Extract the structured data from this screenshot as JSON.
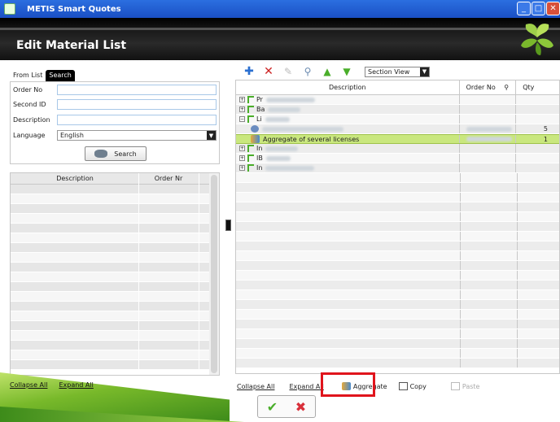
{
  "window": {
    "title": "METIS Smart Quotes"
  },
  "header": {
    "page_title": "Edit Material List"
  },
  "left": {
    "tabs": [
      {
        "label": "From List"
      },
      {
        "label": "Search"
      }
    ],
    "form": {
      "order_no_label": "Order No",
      "second_id_label": "Second ID",
      "description_label": "Description",
      "language_label": "Language",
      "language_value": "English",
      "search_button": "Search"
    },
    "list_columns": {
      "description": "Description",
      "order_nr": "Order Nr"
    },
    "links": {
      "collapse_all": "Collapse All",
      "expand_all": "Expand All"
    }
  },
  "toolbar": {
    "view_select": "Section View"
  },
  "grid": {
    "columns": {
      "description": "Description",
      "order_no": "Order No",
      "qty": "Qty"
    },
    "rows": [
      {
        "desc": "Pr",
        "qty": ""
      },
      {
        "desc": "Ba",
        "qty": ""
      },
      {
        "desc": "Li",
        "qty": ""
      },
      {
        "desc": "",
        "qty": "5"
      },
      {
        "desc": "Aggregate of several licenses",
        "qty": "1"
      },
      {
        "desc": "In",
        "qty": ""
      },
      {
        "desc": "IB",
        "qty": ""
      },
      {
        "desc": "In",
        "qty": ""
      }
    ]
  },
  "bottom": {
    "collapse_all": "Collapse All",
    "expand_all": "Expand All",
    "aggregate": "Aggregate",
    "copy": "Copy",
    "paste": "Paste"
  },
  "colors": {
    "accent_green": "#c9e77e",
    "highlight_red": "#e0141c",
    "title_blue": "#2b6fe0"
  }
}
